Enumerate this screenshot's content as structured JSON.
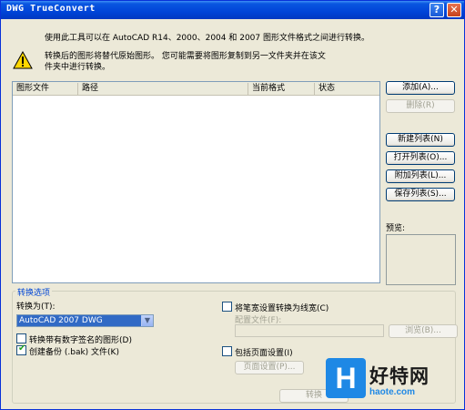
{
  "window": {
    "title": "DWG TrueConvert",
    "help_glyph": "?",
    "close_glyph": "✕"
  },
  "info": {
    "line1": "使用此工具可以在 AutoCAD R14、2000、2004 和 2007 图形文件格式之间进行转换。",
    "line2": "转换后的图形将替代原始图形。 您可能需要将图形复制到另一文件夹并在该文",
    "line3": "件夹中进行转换。",
    "icon": "warning-icon"
  },
  "list": {
    "columns": [
      "图形文件",
      "路径",
      "当前格式",
      "状态"
    ]
  },
  "buttons": {
    "add": "添加(A)...",
    "remove": "删除(R)",
    "new_list": "新建列表(N)",
    "open_list": "打开列表(O)...",
    "append_list": "附加列表(L)...",
    "save_list": "保存列表(S)...",
    "browse": "浏览(B)...",
    "page_setup": "页面设置(P)...",
    "convert": "转换"
  },
  "preview": {
    "label": "预览:"
  },
  "options": {
    "group_label": "转换选项",
    "convert_to_label": "转换为(T):",
    "convert_to_value": "AutoCAD 2007 DWG",
    "digital_sig_label": "转换带有数字签名的图形(D)",
    "digital_sig_checked": false,
    "backup_label": "创建备份 (.bak) 文件(K)",
    "backup_checked": true,
    "linewidth_label": "将笔宽设置转换为线宽(C)",
    "linewidth_checked": false,
    "config_label": "配置文件(F):",
    "page_setup_label": "包括页面设置(I)",
    "page_setup_checked": false
  },
  "watermark": {
    "cn": "好特网",
    "url": "haote.com",
    "letter": "H"
  },
  "colors": {
    "titlebar": "#0044d8",
    "group_label": "#0046d5",
    "accent": "#316ac5"
  }
}
